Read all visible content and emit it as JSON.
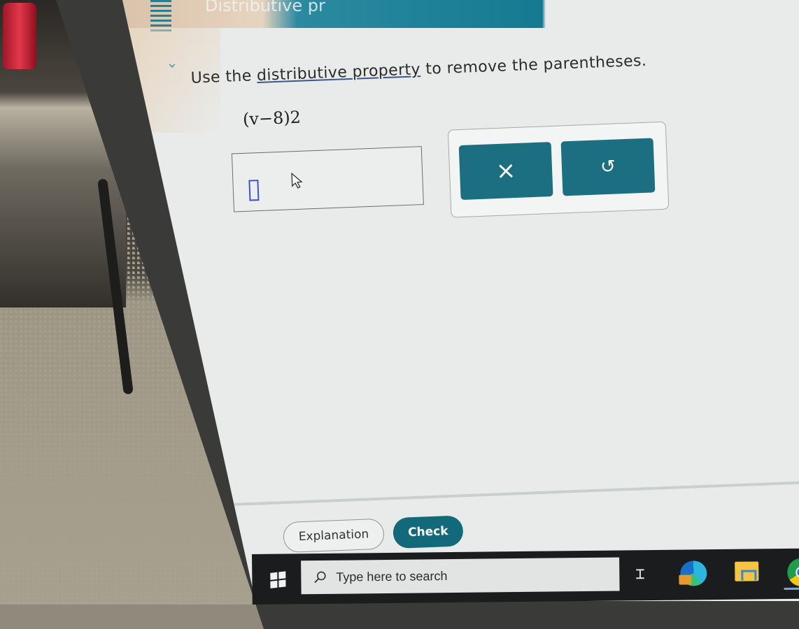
{
  "header": {
    "title": "Distributive pr",
    "menu_icon": "menu-icon",
    "collapse_icon": "chevron-down-icon"
  },
  "question": {
    "prompt_before": "Use the ",
    "prompt_link": "distributive property",
    "prompt_after": " to remove the parentheses.",
    "expression": "(v−8)2"
  },
  "answer": {
    "value": "",
    "cursor_icon": "text-cursor-box",
    "mouse_icon": "mouse-pointer-icon"
  },
  "keypad": {
    "clear_label": "×",
    "undo_label": "↺"
  },
  "footer": {
    "explanation_label": "Explanation",
    "check_label": "Check"
  },
  "taskbar": {
    "search_placeholder": "Type here to search",
    "taskview_label": "⌶",
    "apps": [
      "start-icon",
      "task-view-icon",
      "edge-icon",
      "file-explorer-icon",
      "chrome-icon"
    ]
  },
  "colors": {
    "accent": "#11697a",
    "keypad_button": "#1b6f80",
    "screen_bg": "#e9ebea",
    "cursor_box": "#3b55c8",
    "taskbar_bg": "#1a1c1d"
  }
}
